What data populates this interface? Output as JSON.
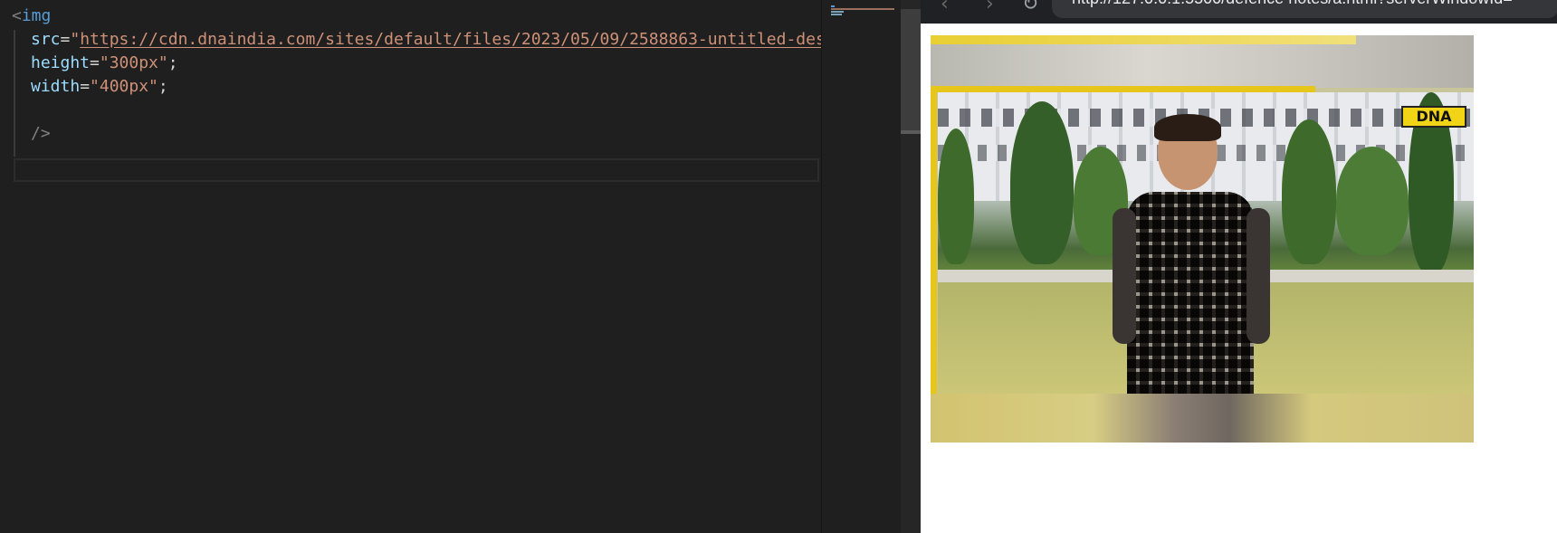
{
  "editor": {
    "lines": {
      "l1": {
        "open": "<",
        "tag": "img"
      },
      "l2": {
        "attr": "src",
        "eq": "=",
        "quote": "\"",
        "value": "https://cdn.dnaindia.com/sites/default/files/2023/05/09/2588863-untitled-design-2023-05-09t172030.jpg"
      },
      "l3": {
        "attr": "height",
        "eq": "=",
        "value": "\"300px\"",
        "semi": ";"
      },
      "l4": {
        "attr": "width",
        "eq": "=",
        "value": "\"400px\"",
        "semi": ";"
      },
      "l6": {
        "close": "/>"
      }
    }
  },
  "browser": {
    "back_glyph": "‹",
    "forward_glyph": "›",
    "reload_glyph": "↻",
    "url": "http://127.0.0.1:5500/defence notes/a.html?serverWindowId=",
    "image": {
      "badge_text": "DNA",
      "icon": "photo-of-student"
    }
  },
  "colors": {
    "editor_bg": "#1f1f1f",
    "tag": "#569cd6",
    "attribute": "#9cdcfe",
    "string": "#ce9178",
    "punctuation": "#808080",
    "browser_bg": "#ffffff",
    "badge_yellow": "#f2d417"
  }
}
